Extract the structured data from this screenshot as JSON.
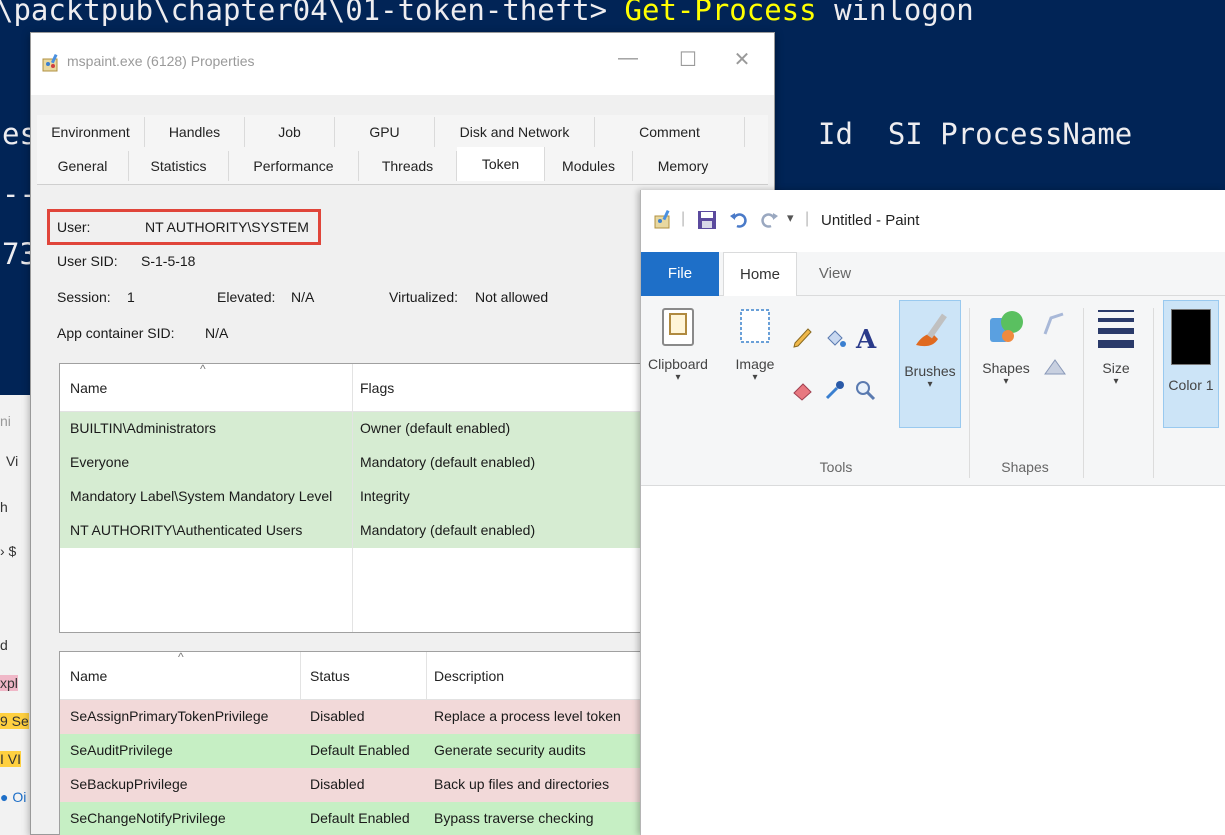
{
  "powershell": {
    "line1_prompt": "\\packtpub\\chapter04\\01-token-theft> ",
    "line1_cmd": "Get-Process",
    "line1_arg": " winlogon",
    "header_left": "es",
    "header_right": "Id  SI ProcessName",
    "line3_left": "--",
    "line4_left": "73"
  },
  "left_strip": {
    "items": [
      "ni",
      "Vi",
      "h",
      "› $",
      "d",
      "xpl",
      "9 Se",
      "I VI",
      "● Oi"
    ]
  },
  "properties": {
    "title": "mspaint.exe (6128) Properties",
    "minimize": "—",
    "maximize": "☐",
    "close": "✕",
    "tabs_row1": [
      "Environment",
      "Handles",
      "Job",
      "GPU",
      "Disk and Network",
      "Comment"
    ],
    "tabs_row2": [
      "General",
      "Statistics",
      "Performance",
      "Threads",
      "Token",
      "Modules",
      "Memory"
    ],
    "active_tab": "Token",
    "user_label": "User:",
    "user_value": "NT AUTHORITY\\SYSTEM",
    "sid_label": "User SID:",
    "sid_value": "S-1-5-18",
    "session_label": "Session:",
    "session_value": "1",
    "elevated_label": "Elevated:",
    "elevated_value": "N/A",
    "virtualized_label": "Virtualized:",
    "virtualized_value": "Not allowed",
    "appcontainer_label": "App container SID:",
    "appcontainer_value": "N/A",
    "groups": {
      "columns": [
        "Name",
        "Flags"
      ],
      "rows": [
        {
          "name": "BUILTIN\\Administrators",
          "flags": "Owner (default enabled)"
        },
        {
          "name": "Everyone",
          "flags": "Mandatory (default enabled)"
        },
        {
          "name": "Mandatory Label\\System Mandatory Level",
          "flags": "Integrity"
        },
        {
          "name": "NT AUTHORITY\\Authenticated Users",
          "flags": "Mandatory (default enabled)"
        }
      ]
    },
    "privileges": {
      "columns": [
        "Name",
        "Status",
        "Description"
      ],
      "rows": [
        {
          "name": "SeAssignPrimaryTokenPrivilege",
          "status": "Disabled",
          "description": "Replace a process level token"
        },
        {
          "name": "SeAuditPrivilege",
          "status": "Default Enabled",
          "description": "Generate security audits"
        },
        {
          "name": "SeBackupPrivilege",
          "status": "Disabled",
          "description": "Back up files and directories"
        },
        {
          "name": "SeChangeNotifyPrivilege",
          "status": "Default Enabled",
          "description": "Bypass traverse checking"
        }
      ]
    }
  },
  "paint": {
    "title": "Untitled - Paint",
    "qat_dropdown": "▾",
    "tabs": {
      "file": "File",
      "home": "Home",
      "view": "View"
    },
    "buttons": {
      "clipboard": "Clipboard",
      "image": "Image",
      "brushes": "Brushes",
      "shapes": "Shapes",
      "size": "Size",
      "color": "Color 1"
    },
    "groups": {
      "tools": "Tools",
      "shapes": "Shapes"
    },
    "colors": {
      "file_tab": "#1e6fc8",
      "color1": "#000000"
    }
  }
}
